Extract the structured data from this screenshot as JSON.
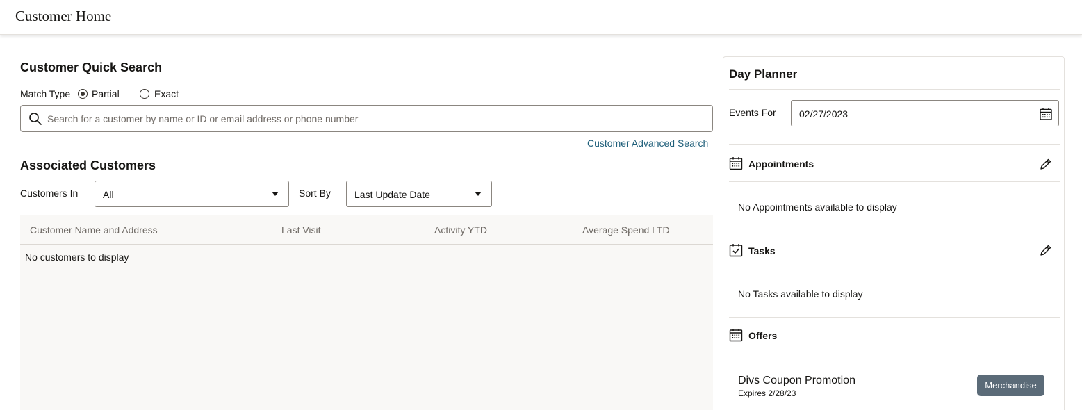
{
  "header": {
    "title": "Customer Home"
  },
  "quick_search": {
    "heading": "Customer Quick Search",
    "match_type_label": "Match Type",
    "match_options": [
      {
        "label": "Partial",
        "selected": true
      },
      {
        "label": "Exact",
        "selected": false
      }
    ],
    "search_placeholder": "Search for a customer by name or ID or email address or phone number",
    "search_value": "",
    "advanced_link": "Customer Advanced Search"
  },
  "associated": {
    "heading": "Associated Customers",
    "customers_in_label": "Customers In",
    "customers_in_value": "All",
    "sort_by_label": "Sort By",
    "sort_by_value": "Last Update Date",
    "columns": [
      "Customer Name and Address",
      "Last Visit",
      "Activity YTD",
      "Average Spend LTD"
    ],
    "empty_message": "No customers to display"
  },
  "planner": {
    "heading": "Day Planner",
    "events_for_label": "Events For",
    "events_for_date": "02/27/2023",
    "appointments": {
      "title": "Appointments",
      "empty": "No Appointments available to display"
    },
    "tasks": {
      "title": "Tasks",
      "empty": "No Tasks available to display"
    },
    "offers": {
      "title": "Offers",
      "items": [
        {
          "name": "Divs Coupon Promotion",
          "expires": "Expires 2/28/23",
          "tag": "Merchandise"
        }
      ]
    }
  },
  "colors": {
    "link": "#1f5f7a",
    "badge": "#5b6b78",
    "table_bg": "#f9f8f6",
    "border": "#8b8680"
  }
}
